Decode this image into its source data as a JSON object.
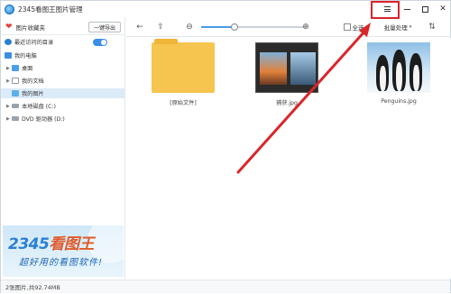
{
  "window": {
    "title": "2345看图王图片管理"
  },
  "sidebar": {
    "favorites_label": "图片收藏夹",
    "export_label": "一键导出",
    "tree": [
      {
        "label": "最近访问的目录",
        "icon": "recent-icon"
      },
      {
        "label": "我的电脑",
        "icon": "computer-icon"
      },
      {
        "label": "桌面",
        "icon": "desktop-icon"
      },
      {
        "label": "我的文档",
        "icon": "document-icon"
      },
      {
        "label": "我的图片",
        "icon": "pictures-icon",
        "selected": true
      },
      {
        "label": "本地磁盘 (C:)",
        "icon": "disk-icon"
      },
      {
        "label": "DVD 驱动器 (D:)",
        "icon": "dvd-icon"
      }
    ],
    "banner": {
      "title_num": "2345",
      "title_cn": "看图王",
      "subtitle": "超好用的看图软件!"
    }
  },
  "toolbar": {
    "select_all_label": "全选",
    "batch_label": "批量处理",
    "zoom_fraction": 0.32
  },
  "files": [
    {
      "name": "[原始文件]",
      "kind": "folder"
    },
    {
      "name": "捕获.jpg",
      "kind": "screenshot"
    },
    {
      "name": "Penguins.jpg",
      "kind": "penguins"
    }
  ],
  "status": {
    "text": "2张图片,共92.74MB"
  },
  "colors": {
    "accent": "#2a80d5",
    "highlight": "#d9262b"
  }
}
